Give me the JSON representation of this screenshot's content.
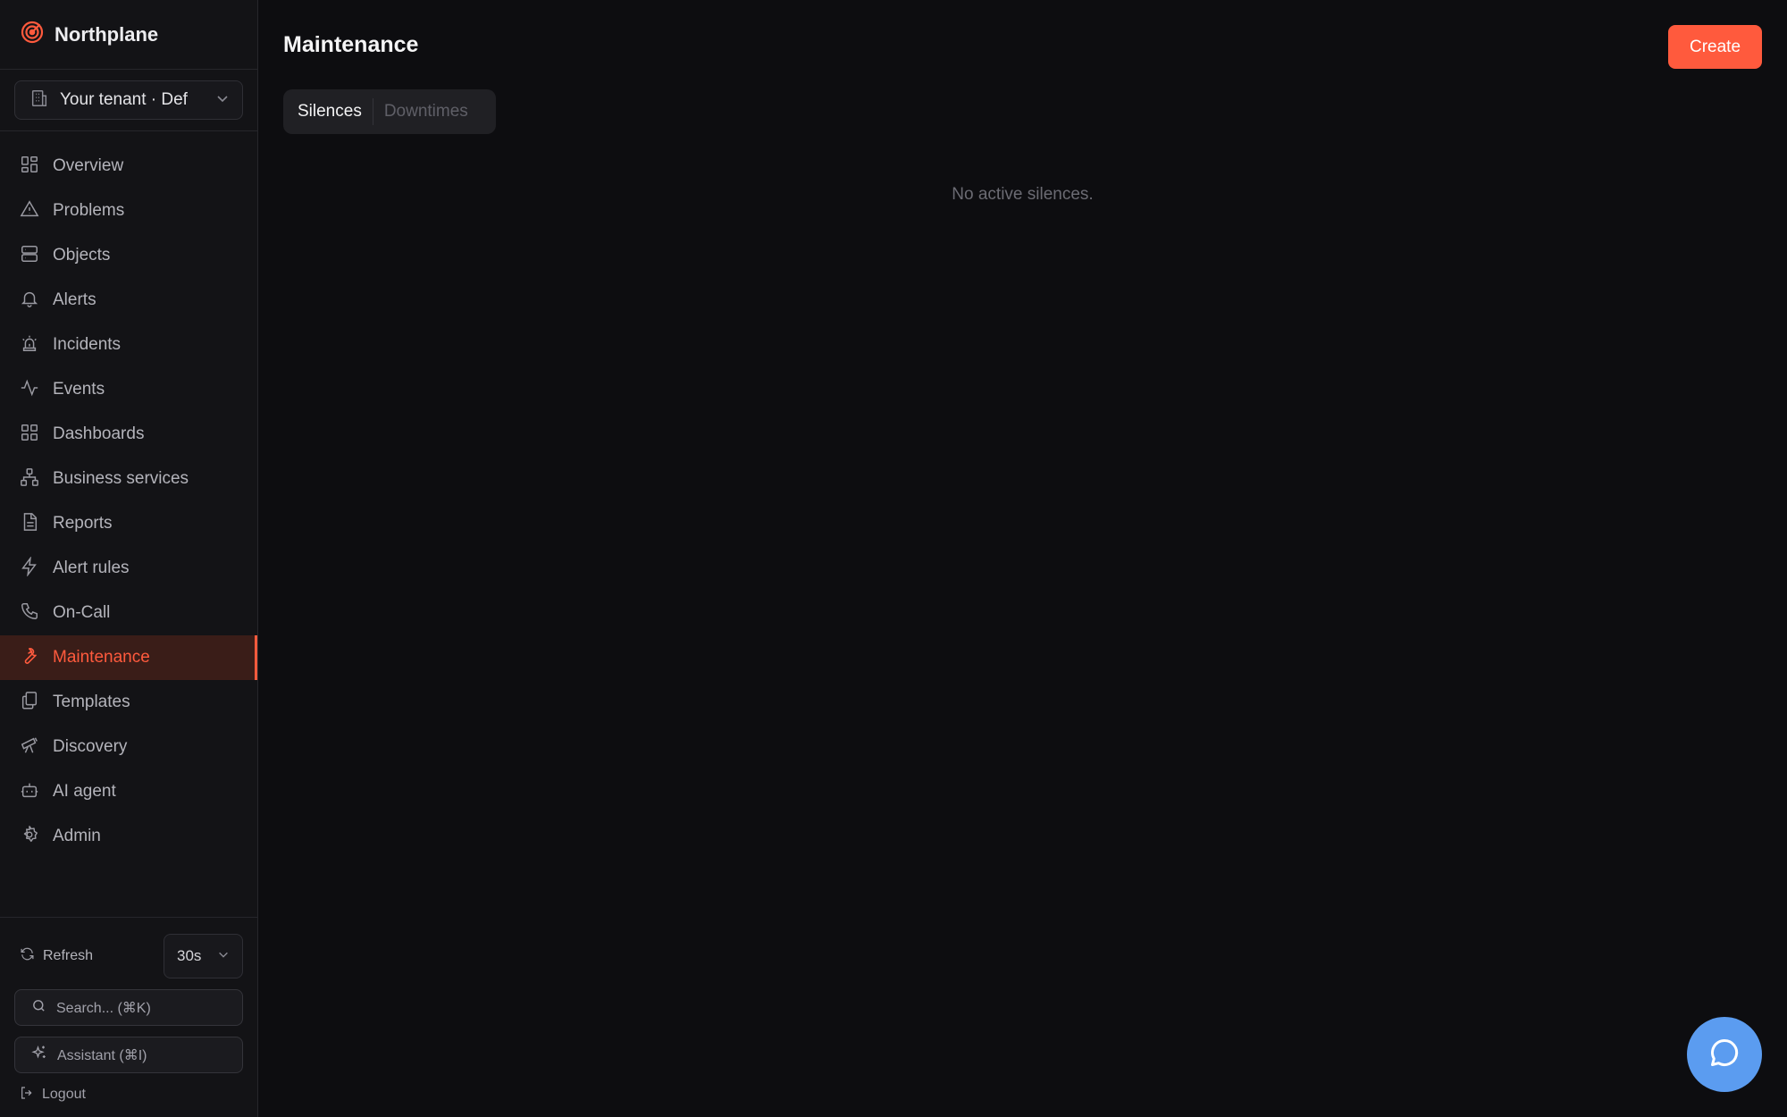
{
  "brand": {
    "name": "Northplane",
    "accent": "#ff5a3d"
  },
  "tenant": {
    "label": "Your tenant · Def"
  },
  "nav": {
    "items": [
      {
        "label": "Overview",
        "icon": "layout-grid-icon"
      },
      {
        "label": "Problems",
        "icon": "warning-triangle-icon"
      },
      {
        "label": "Objects",
        "icon": "server-icon"
      },
      {
        "label": "Alerts",
        "icon": "bell-icon"
      },
      {
        "label": "Incidents",
        "icon": "siren-icon"
      },
      {
        "label": "Events",
        "icon": "activity-icon"
      },
      {
        "label": "Dashboards",
        "icon": "dashboard-grid-icon"
      },
      {
        "label": "Business services",
        "icon": "network-icon"
      },
      {
        "label": "Reports",
        "icon": "document-icon"
      },
      {
        "label": "Alert rules",
        "icon": "lightning-icon"
      },
      {
        "label": "On-Call",
        "icon": "phone-icon"
      },
      {
        "label": "Maintenance",
        "icon": "wrench-icon",
        "active": true
      },
      {
        "label": "Templates",
        "icon": "copy-icon"
      },
      {
        "label": "Discovery",
        "icon": "telescope-icon"
      },
      {
        "label": "AI agent",
        "icon": "bot-icon"
      },
      {
        "label": "Admin",
        "icon": "gear-icon"
      }
    ]
  },
  "footer": {
    "refresh_label": "Refresh",
    "refresh_interval": "30s",
    "search_placeholder": "Search... (⌘K)",
    "assistant_label": "Assistant (⌘I)",
    "logout_label": "Logout"
  },
  "main": {
    "title": "Maintenance",
    "create_label": "Create",
    "tabs": [
      {
        "label": "Silences",
        "active": true
      },
      {
        "label": "Downtimes",
        "active": false
      }
    ],
    "empty_message": "No active silences."
  },
  "colors": {
    "background": "#0d0d10",
    "sidebar": "#131316",
    "accent": "#ff5a3d",
    "chat_button": "#5b9cf0"
  }
}
